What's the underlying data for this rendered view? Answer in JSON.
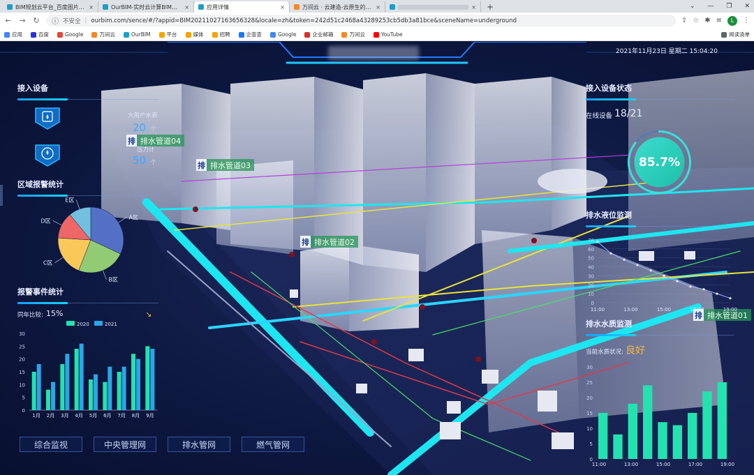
{
  "browser": {
    "tabs": [
      {
        "label": "BIM规划云平台_百度图片搜索",
        "active": false
      },
      {
        "label": "OurBIM-实时云计算BIM引擎平台",
        "active": false
      },
      {
        "label": "应用详情",
        "active": true
      },
      {
        "label": "万间云 · 云建造-云原生的BIM协同",
        "active": false
      },
      {
        "label": "",
        "active": false
      }
    ],
    "new_tab": "+",
    "insecure_label": "不安全",
    "url": "ourbim.com/sence/#/?appid=BIM20211027163656328&locale=zh&token=242d51c2468a43289253cb5db3a81bce&sceneName=underground",
    "avatar_letter": "L",
    "bookmarks": [
      "应用",
      "百度",
      "Google",
      "万间云",
      "OurBIM",
      "平台",
      "媒体",
      "招聘",
      "企查查",
      "Google",
      "企业邮箱",
      "万间云",
      "YouTube"
    ],
    "reading_list": "阅读清单"
  },
  "header": {
    "datetime": "2021年11月23日 星期二 15:04:20"
  },
  "left": {
    "devices_title": "接入设备",
    "device_icons": [
      "water-meter-icon",
      "pressure-gauge-icon"
    ],
    "alarm_region_title": "区域报警统计",
    "alarm_event_title": "报警事件统计",
    "ratio_label": "同年比较:",
    "ratio_value": "15%",
    "trend_icon": "trend-down-icon"
  },
  "scene": {
    "meter_label": "大用户水表",
    "meter_value": "20",
    "meter_unit": "个",
    "gauge_label": "压力计",
    "gauge_value": "50",
    "gauge_unit": "个",
    "pipe_icon_text": "排",
    "pipe_tags": [
      "排水管道04",
      "排水管道03",
      "排水管道02",
      "排水管道01"
    ]
  },
  "right": {
    "status_title": "接入设备状态",
    "online_label": "在线设备",
    "online_value": "18/21",
    "online_percent": "85.7%",
    "online_fraction": 0.857,
    "level_title": "排水液位监测",
    "quality_title": "排水水质监测",
    "quality_label": "当前水质状况:",
    "quality_value": "良好"
  },
  "bottom_nav": [
    "综合监视",
    "中央管理网",
    "排水管网",
    "燃气管网"
  ],
  "colors": {
    "accent": "#17d3ff",
    "series_2020": "#22e3b0",
    "series_2021": "#2aa6e8",
    "gold": "#f2b84b"
  },
  "chart_data": [
    {
      "id": "region-alarm-pie",
      "type": "pie",
      "labels": [
        "A区",
        "B区",
        "C区",
        "D区",
        "E区"
      ],
      "values": [
        32,
        24,
        20,
        13,
        11
      ],
      "colors": [
        "#5470c6",
        "#91cc75",
        "#fac858",
        "#ee6666",
        "#73c0de"
      ]
    },
    {
      "id": "alarm-event-bar",
      "type": "bar",
      "categories": [
        "1月",
        "2月",
        "3月",
        "4月",
        "5月",
        "6月",
        "7月",
        "8月",
        "9月"
      ],
      "series": [
        {
          "name": "2020",
          "values": [
            15,
            8,
            18,
            24,
            12,
            11,
            15,
            22,
            25
          ]
        },
        {
          "name": "2021",
          "values": [
            18,
            11,
            22,
            26,
            14,
            17,
            17,
            20,
            24
          ]
        }
      ],
      "ylim": [
        0,
        30
      ],
      "yticks": [
        0,
        5,
        10,
        15,
        20,
        25,
        30
      ],
      "legend": "top-center"
    },
    {
      "id": "drain-level-line",
      "type": "line",
      "categories": [
        "11:00",
        "13:00",
        "15:00",
        "17:00",
        "19:00"
      ],
      "x": [
        0,
        0.4,
        0.8,
        1.2,
        1.6,
        2.0,
        2.4,
        2.8,
        3.2,
        3.6,
        4.0
      ],
      "values": [
        68,
        55,
        48,
        42,
        36,
        30,
        24,
        18,
        15,
        10,
        5
      ],
      "ylim": [
        0,
        70
      ],
      "yticks": [
        0,
        10,
        20,
        30,
        40,
        50,
        60,
        70
      ]
    },
    {
      "id": "water-quality-bar",
      "type": "bar",
      "categories": [
        "11:00",
        "13:00",
        "15:00",
        "17:00",
        "19:00"
      ],
      "values": [
        15,
        8,
        18,
        24,
        12,
        11,
        15,
        22,
        25
      ],
      "ylim": [
        0,
        30
      ],
      "yticks": [
        0,
        5,
        10,
        15,
        20,
        25,
        30
      ]
    }
  ]
}
